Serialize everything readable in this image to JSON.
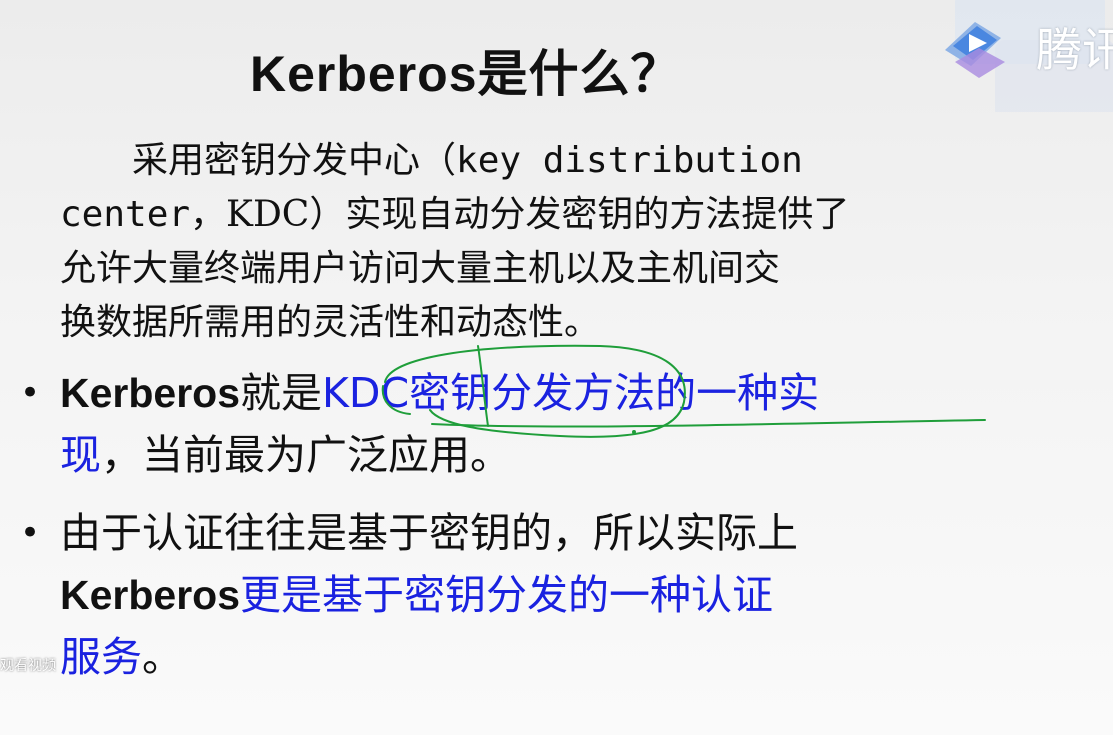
{
  "slide": {
    "title": "Kerberos是什么？",
    "intro_lines": [
      {
        "cn": "采用密钥分发中心（",
        "en": "key distribution"
      },
      {
        "en": "center",
        "cn": "，KDC）实现自动分发密钥的方法提供了"
      },
      {
        "cn": "允许大量终端用户访问大量主机以及主机间交"
      },
      {
        "cn": "换数据所需用的灵活性和动态性。"
      }
    ],
    "bullet1": {
      "term": "Kerberos",
      "connector": "就是",
      "highlight_line1": "KDC密钥分发方法的一种实",
      "highlight_line2": "现",
      "rest": "，当前最为广泛应用。"
    },
    "bullet2": {
      "line1": "由于认证往往是基于密钥的，所以实际上",
      "term": "Kerberos",
      "highlight_line2": "更是基于密钥分发的一种认证",
      "highlight_line3": "服务",
      "end": "。"
    },
    "overlay": {
      "logo_text": "腾讯",
      "watch_label": "观看视频"
    },
    "colors": {
      "text": "#111111",
      "highlight": "#1a22e0",
      "annotation": "#1f9e3a"
    },
    "icons": {
      "bullet": "bullet-dot-icon",
      "logo": "tencent-video-logo-icon"
    }
  }
}
